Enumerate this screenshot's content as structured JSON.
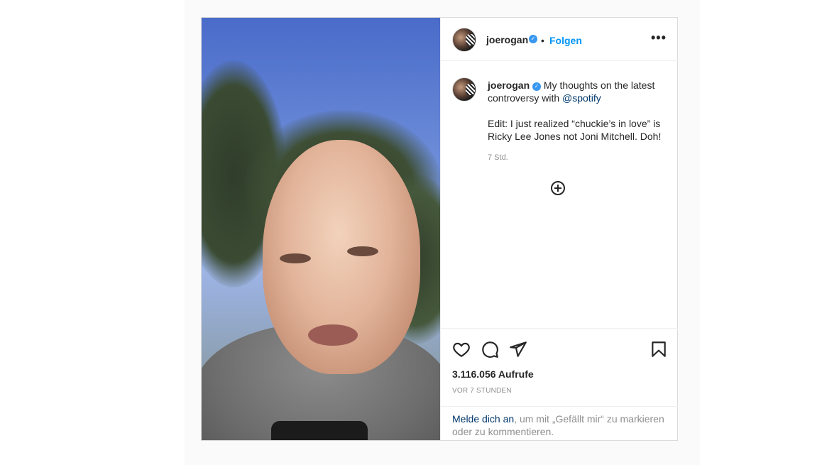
{
  "header": {
    "username": "joerogan",
    "separator": "•",
    "follow_label": "Folgen",
    "more_glyph": "•••"
  },
  "caption": {
    "username": "joerogan",
    "text_before": "My thoughts on the latest controversy with",
    "mention": "@spotify",
    "edit_text": "Edit: I just realized “chuckie’s in love” is Ricky Lee Jones not Joni Mitchell. Doh!",
    "time": "7 Std."
  },
  "actions": {
    "views": "3.116.056 Aufrufe",
    "posted_ago": "VOR 7 STUNDEN",
    "icons": [
      "heart-icon",
      "comment-icon",
      "share-icon",
      "bookmark-icon"
    ]
  },
  "login": {
    "link": "Melde dich an",
    "rest": ", um mit „Gefällt mir“ zu markieren oder zu kommentieren."
  },
  "colors": {
    "link_blue": "#0095f6",
    "mention_blue": "#00376b",
    "verified_blue": "#3897f0",
    "muted_text": "#8e8e8e",
    "border": "#dbdbdb"
  }
}
